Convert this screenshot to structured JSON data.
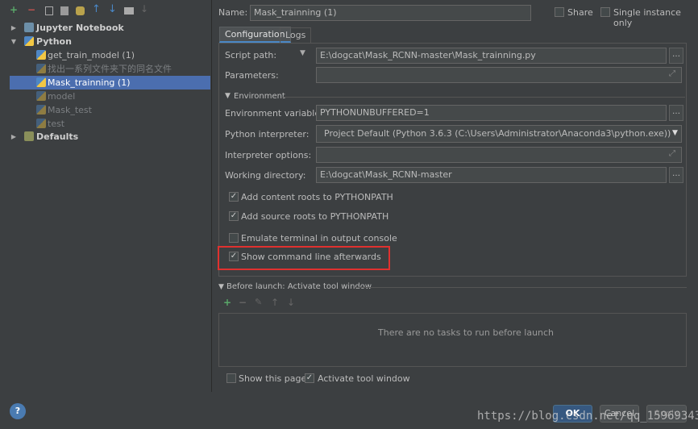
{
  "toolbar": {
    "icons": [
      "add-icon",
      "remove-icon",
      "copy-icon",
      "save-icon",
      "edit-defaults-icon",
      "move-up-icon",
      "move-down-icon",
      "folder-icon",
      "sort-icon"
    ],
    "add_glyph": "+",
    "remove_glyph": "−"
  },
  "tree": {
    "jupyter": "Jupyter Notebook",
    "python": "Python",
    "items": [
      "get_train_model (1)",
      "找出一系列文件夹下的同名文件",
      "Mask_trainning (1)",
      "model",
      "Mask_test",
      "test"
    ],
    "defaults": "Defaults"
  },
  "header": {
    "name_label": "Name:",
    "name_value": "Mask_trainning (1)",
    "share_label": "Share",
    "single_instance_label": "Single instance only"
  },
  "tabs": [
    "Configuration",
    "Logs"
  ],
  "config": {
    "script_path_label": "Script path:",
    "script_path_value": "E:\\dogcat\\Mask_RCNN-master\\Mask_trainning.py",
    "parameters_label": "Parameters:",
    "parameters_value": "",
    "environment_section": "Environment",
    "env_vars_label": "Environment variables:",
    "env_vars_value": "PYTHONUNBUFFERED=1",
    "interpreter_label": "Python interpreter:",
    "interpreter_value": "Project Default (Python 3.6.3 (C:\\Users\\Administrator\\Anaconda3\\python.exe))",
    "interp_options_label": "Interpreter options:",
    "interp_options_value": "",
    "working_dir_label": "Working directory:",
    "working_dir_value": "E:\\dogcat\\Mask_RCNN-master",
    "checkboxes": [
      {
        "label": "Add content roots to PYTHONPATH",
        "checked": true
      },
      {
        "label": "Add source roots to PYTHONPATH",
        "checked": true
      },
      {
        "label": "Emulate terminal in output console",
        "checked": false
      },
      {
        "label": "Show command line afterwards",
        "checked": true
      }
    ]
  },
  "before_launch": {
    "title": "Before launch: Activate tool window",
    "empty_text": "There are no tasks to run before launch",
    "show_page_label": "Show this page",
    "activate_tool_window_label": "Activate tool window"
  },
  "footer": {
    "ok": "OK",
    "cancel": "Cancel",
    "apply": "Apply",
    "help": "?"
  },
  "watermark": "https://blog.csdn.net/qq_15969343",
  "colors": {
    "selection": "#4b6eaf",
    "highlight_box": "#e0312f",
    "add_green": "#59a869",
    "remove_red": "#c75450",
    "arrow_blue": "#4a88c7"
  }
}
